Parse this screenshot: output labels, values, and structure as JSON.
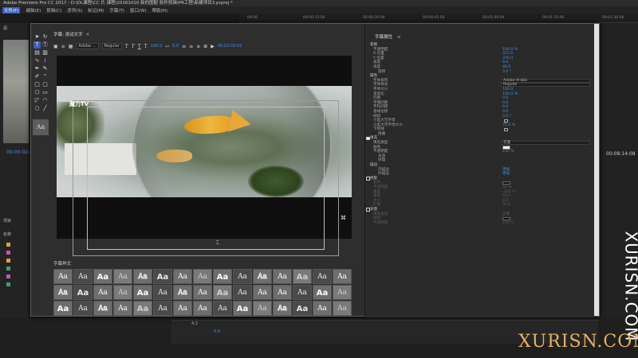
{
  "window": {
    "title": "Adobe Premiere Pro CC 2017 - D:\\DL课程\\CC 片 课程\\20161010 新的图配 软件剪辑\\PR工程\\新建项目3.prproj *"
  },
  "menu": [
    "文件(F)",
    "编辑(E)",
    "剪辑(C)",
    "序列(S)",
    "标记(M)",
    "字幕(T)",
    "窗口(W)",
    "帮助(H)"
  ],
  "timeline_ticks": [
    "00:00",
    "00:00:15:00",
    "00:00:30:00",
    "00:00:45:00",
    "00:01:00:00",
    "00:01:15:00",
    "00:01:30:00"
  ],
  "background": {
    "left_panel_label": "源",
    "left_time": "00:00:02:",
    "right_time": "00:08:14:08",
    "project_label": "项目",
    "name_label": "名称",
    "bottom_value": "4.2",
    "bottom_value2": "0:0"
  },
  "titler": {
    "tab_label": "字幕: 测试文字",
    "toolbar": {
      "font": "Adobe ...",
      "style": "Regular",
      "size": "100.0",
      "kerning": "0.0",
      "timecode": "00:02:03:01"
    },
    "tool_icons": [
      "selection-tool",
      "rotation-tool",
      "type-tool",
      "vertical-type-tool",
      "area-type-tool",
      "vertical-area-type-tool",
      "path-type-tool",
      "vertical-path-type-tool",
      "pen-tool",
      "delete-anchor-tool",
      "add-anchor-tool",
      "convert-anchor-tool",
      "rectangle-tool",
      "rounded-rect-tool",
      "clipped-corner-tool",
      "rounded-corner-tool",
      "wedge-tool",
      "arc-tool",
      "ellipse-tool",
      "line-tool"
    ],
    "stage_title_text": "魔力TV",
    "aa_label": "Aa",
    "styles_tab": "字幕样式",
    "styles_label": "Aa",
    "props_tab": "字幕属性"
  },
  "properties": [
    {
      "label": "变换",
      "kind": "section"
    },
    {
      "label": "不透明度",
      "value": "100.0 %"
    },
    {
      "label": "X 位置",
      "value": "372.6"
    },
    {
      "label": "Y 位置",
      "value": "376.4"
    },
    {
      "label": "宽度",
      "value": "0.0"
    },
    {
      "label": "高度",
      "value": "40.0"
    },
    {
      "label": "旋转",
      "value": "0.0 °",
      "kind": "sub"
    },
    {
      "label": "属性",
      "kind": "section"
    },
    {
      "label": "字体系列",
      "value": "Adobe Arabic",
      "kind": "field"
    },
    {
      "label": "字体样式",
      "value": "Regular",
      "kind": "field"
    },
    {
      "label": "字体大小",
      "value": "100.0"
    },
    {
      "label": "宽高比",
      "value": "100.0 %"
    },
    {
      "label": "行距",
      "value": "0.0"
    },
    {
      "label": "字偶间距",
      "value": "0.0"
    },
    {
      "label": "字符间距",
      "value": "0.0"
    },
    {
      "label": "基线位移",
      "value": "0.0"
    },
    {
      "label": "倾斜",
      "value": "0.0 °"
    },
    {
      "label": "小型大写字母",
      "kind": "check"
    },
    {
      "label": "小型大写字母大小",
      "value": "75.0 %"
    },
    {
      "label": "下划线",
      "kind": "check"
    },
    {
      "label": "扭曲",
      "kind": "sub"
    },
    {
      "label": "填充",
      "kind": "checked-section"
    },
    {
      "label": "填充类型",
      "value": "实底",
      "kind": "field"
    },
    {
      "label": "颜色",
      "kind": "color-white"
    },
    {
      "label": "不透明度",
      "value": "100 %"
    },
    {
      "label": "光泽",
      "kind": "sub"
    },
    {
      "label": "纹理",
      "kind": "sub"
    },
    {
      "label": "描边",
      "kind": "section"
    },
    {
      "label": "内描边",
      "value": "添加",
      "kind": "sub"
    },
    {
      "label": "外描边",
      "value": "添加",
      "kind": "sub"
    },
    {
      "label": "阴影",
      "kind": "unchecked-section"
    },
    {
      "label": "颜色",
      "kind": "color-black-dim"
    },
    {
      "label": "不透明度",
      "value": "50 %",
      "kind": "dim"
    },
    {
      "label": "角度",
      "value": "-205.0 °",
      "kind": "dim"
    },
    {
      "label": "距离",
      "value": "10.0",
      "kind": "dim"
    },
    {
      "label": "大小",
      "value": "0.0",
      "kind": "dim"
    },
    {
      "label": "扩展",
      "value": "30.0",
      "kind": "dim"
    },
    {
      "label": "背景",
      "kind": "unchecked-section"
    },
    {
      "label": "填充类型",
      "value": "实底",
      "kind": "dim"
    },
    {
      "label": "颜色",
      "kind": "color-black-dim"
    },
    {
      "label": "不透明度",
      "value": "100 %",
      "kind": "dim"
    }
  ],
  "watermark": {
    "vertical": "XURISN.COM",
    "bottom": "XURISN.COM"
  },
  "colors": {
    "accent": "#4a90e2",
    "watermark_bottom": "#e8b060",
    "panel": "#2e2e2e"
  }
}
